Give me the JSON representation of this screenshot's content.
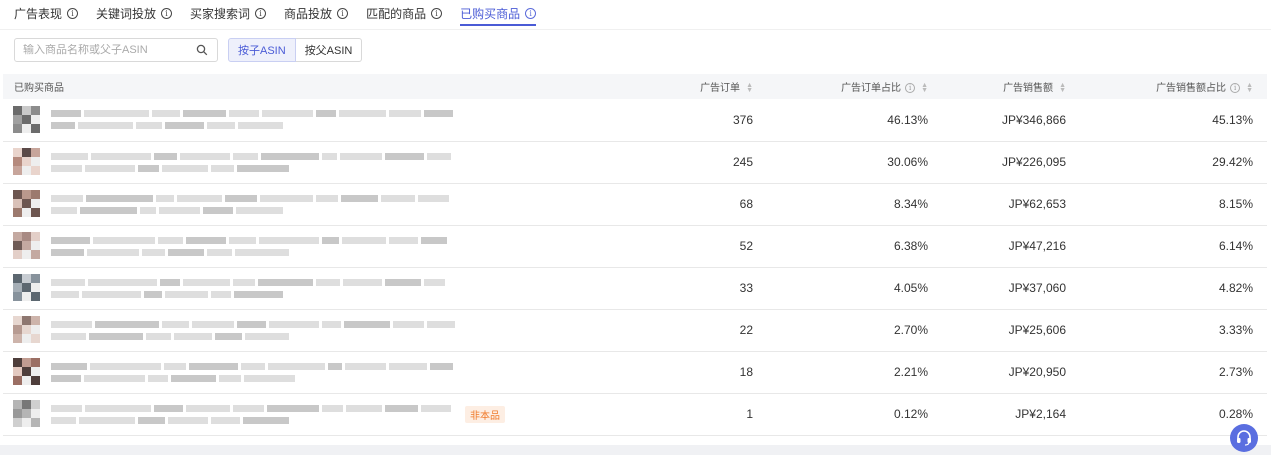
{
  "tabs": [
    {
      "label": "广告表现",
      "active": false
    },
    {
      "label": "关键词投放",
      "active": false
    },
    {
      "label": "买家搜索词",
      "active": false
    },
    {
      "label": "商品投放",
      "active": false
    },
    {
      "label": "匹配的商品",
      "active": false
    },
    {
      "label": "已购买商品",
      "active": true
    }
  ],
  "search": {
    "placeholder": "输入商品名称或父子ASIN",
    "value": ""
  },
  "toggle": {
    "child": "按子ASIN",
    "parent": "按父ASIN",
    "selected": "child"
  },
  "table": {
    "headers": [
      "已购买商品",
      "广告订单",
      "广告订单占比",
      "广告销售额",
      "广告销售额占比"
    ],
    "rows": [
      {
        "orders": "376",
        "order_share": "46.13%",
        "sales": "JP¥346,866",
        "sales_share": "45.13%",
        "tag": ""
      },
      {
        "orders": "245",
        "order_share": "30.06%",
        "sales": "JP¥226,095",
        "sales_share": "29.42%",
        "tag": ""
      },
      {
        "orders": "68",
        "order_share": "8.34%",
        "sales": "JP¥62,653",
        "sales_share": "8.15%",
        "tag": ""
      },
      {
        "orders": "52",
        "order_share": "6.38%",
        "sales": "JP¥47,216",
        "sales_share": "6.14%",
        "tag": ""
      },
      {
        "orders": "33",
        "order_share": "4.05%",
        "sales": "JP¥37,060",
        "sales_share": "4.82%",
        "tag": ""
      },
      {
        "orders": "22",
        "order_share": "2.70%",
        "sales": "JP¥25,606",
        "sales_share": "3.33%",
        "tag": ""
      },
      {
        "orders": "18",
        "order_share": "2.21%",
        "sales": "JP¥20,950",
        "sales_share": "2.73%",
        "tag": ""
      },
      {
        "orders": "1",
        "order_share": "0.12%",
        "sales": "JP¥2,164",
        "sales_share": "0.28%",
        "tag": "非本品"
      }
    ]
  },
  "colors": {
    "accent": "#4a5bd6",
    "tag": "#f07a2a",
    "help_button": "#5a6ee0"
  },
  "icons": {
    "search": "search-icon",
    "info": "info-icon",
    "sort": "sort-icon",
    "help": "customer-service-icon"
  }
}
